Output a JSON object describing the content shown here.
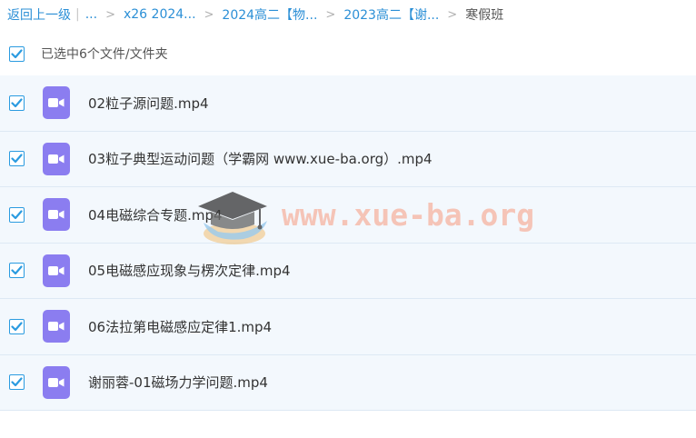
{
  "breadcrumb": {
    "back_label": "返回上一级",
    "ellipsis": "...",
    "items": [
      "x26 2024...",
      "2024高二【物...",
      "2023高二【谢..."
    ],
    "current": "寒假班",
    "separator": ">"
  },
  "selection": {
    "text": "已选中6个文件/文件夹",
    "checked": true
  },
  "files": [
    {
      "name": "02粒子源问题.mp4",
      "checked": true,
      "icon": "video-icon"
    },
    {
      "name": "03粒子典型运动问题（学霸网 www.xue-ba.org）.mp4",
      "checked": true,
      "icon": "video-icon"
    },
    {
      "name": "04电磁综合专题.mp4",
      "checked": true,
      "icon": "video-icon"
    },
    {
      "name": "05电磁感应现象与楞次定律.mp4",
      "checked": true,
      "icon": "video-icon"
    },
    {
      "name": "06法拉第电磁感应定律1.mp4",
      "checked": true,
      "icon": "video-icon"
    },
    {
      "name": "谢丽蓉-01磁场力学问题.mp4",
      "checked": true,
      "icon": "video-icon"
    }
  ],
  "watermark": {
    "text": "www.xue-ba.org"
  },
  "colors": {
    "link": "#2b8fd6",
    "checkbox": "#2b9be0",
    "row_bg": "#f3f8fd",
    "video_icon": "#8b7df0",
    "watermark": "#f6b6a4"
  }
}
